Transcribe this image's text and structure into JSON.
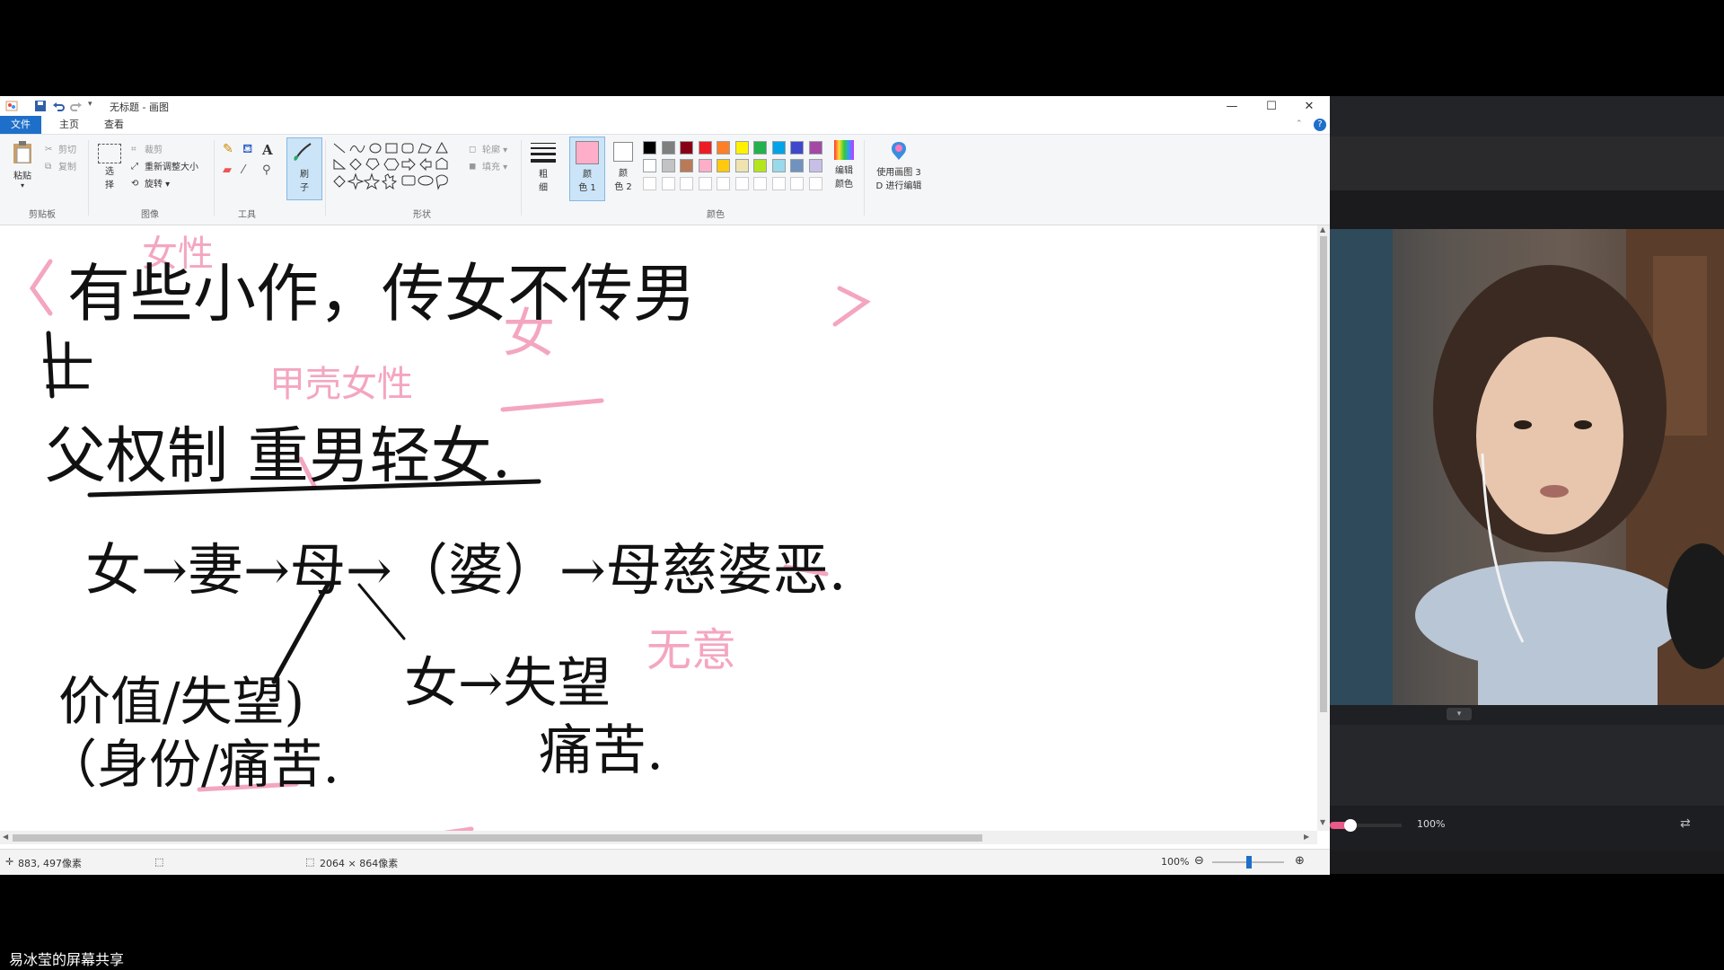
{
  "window": {
    "title": "无标题 - 画图",
    "controls": [
      "—",
      "☐",
      "✕"
    ]
  },
  "tabs": {
    "file": "文件",
    "home": "主页",
    "view": "查看"
  },
  "ribbon": {
    "clipboard": {
      "paste": "粘贴",
      "cut": "剪切",
      "copy": "复制",
      "label": "剪贴板"
    },
    "image": {
      "select_line1": "选",
      "select_line2": "择",
      "crop": "裁剪",
      "resize": "重新调整大小",
      "rotate": "旋转",
      "label": "图像"
    },
    "tools": {
      "label": "工具",
      "text_tool": "A"
    },
    "brushes": {
      "line1": "刷",
      "line2": "子"
    },
    "shapes": {
      "outline": "轮廓",
      "fill": "填充",
      "label": "形状"
    },
    "size": {
      "line1": "粗",
      "line2": "细"
    },
    "color1": {
      "line1": "颜",
      "line2": "色 1"
    },
    "color2": {
      "line1": "颜",
      "line2": "色 2"
    },
    "colors_label": "颜色",
    "edit_colors": {
      "line1": "编辑",
      "line2": "颜色"
    },
    "paint3d": {
      "line1": "使用画图 3",
      "line2": "D 进行编辑"
    }
  },
  "palette": {
    "row1": [
      "#000000",
      "#7f7f7f",
      "#880015",
      "#ed1c24",
      "#ff7f27",
      "#fff200",
      "#22b14c",
      "#00a2e8",
      "#3f48cc",
      "#a349a4"
    ],
    "row2": [
      "#ffffff",
      "#c3c3c3",
      "#b97a57",
      "#ffaec9",
      "#ffc90e",
      "#efe4b0",
      "#b5e61d",
      "#99d9ea",
      "#7092be",
      "#c8bfe7"
    ]
  },
  "colors": {
    "accent": "#1e6fc9",
    "color1_value": "#ffaec9",
    "pink_ink": "#f4a6bf",
    "black_ink": "#111111"
  },
  "canvas_text": {
    "l1_pink_top": "女性",
    "l1": "有些小作，传女不传男",
    "l1_pink_mid": "女",
    "l2_left": "士",
    "l2": "父权制 重男轻女.",
    "l2_pink": "甲壳女性",
    "l3": "女→妻→母→（婆）→母慈婆恶.",
    "l3_pink": "无意",
    "l4": "女→失望",
    "l4b": "痛苦.",
    "l5": "价值/失望)",
    "l6": "（身份/痛苦."
  },
  "status": {
    "cursor": "883, 497像素",
    "size": "2064 × 864像素",
    "zoom": "100%"
  },
  "stream": {
    "volume": "100%",
    "caption": "易冰莹的屏幕共享"
  }
}
